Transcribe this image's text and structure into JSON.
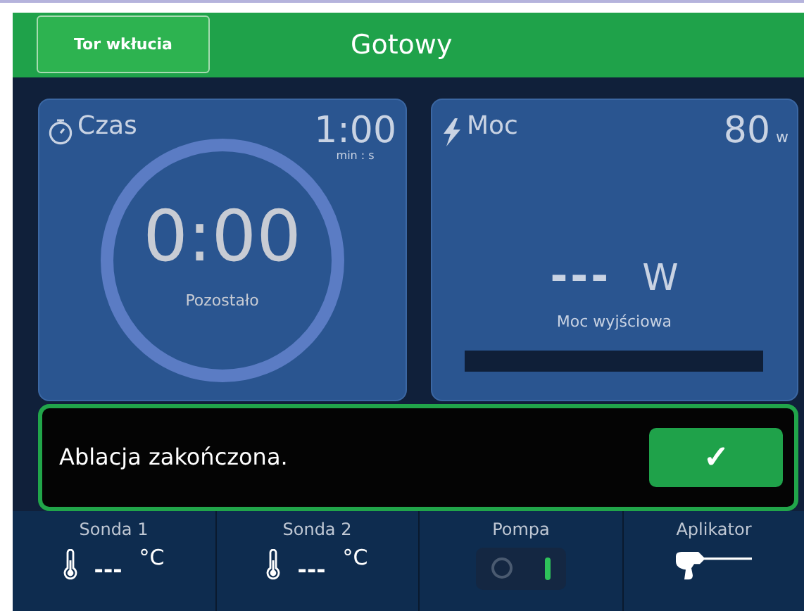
{
  "header": {
    "button": "Tor wkłucia",
    "status": "Gotowy"
  },
  "time_card": {
    "title": "Czas",
    "set_value": "1:00",
    "set_unit": "min : s",
    "remaining": "0:00",
    "remaining_label": "Pozostało"
  },
  "power_card": {
    "title": "Moc",
    "set_value": "80",
    "set_unit": "w",
    "output": "---",
    "output_unit": "W",
    "output_label": "Moc wyjściowa",
    "level": 0
  },
  "alert": {
    "message": "Ablacja zakończona.",
    "confirm": "✓"
  },
  "status_bar": {
    "probes": [
      {
        "label": "Sonda 1",
        "value": "---",
        "unit": "°C"
      },
      {
        "label": "Sonda 2",
        "value": "---",
        "unit": "°C"
      }
    ],
    "pump": {
      "label": "Pompa",
      "on": true
    },
    "applicator": {
      "label": "Aplikator"
    }
  }
}
